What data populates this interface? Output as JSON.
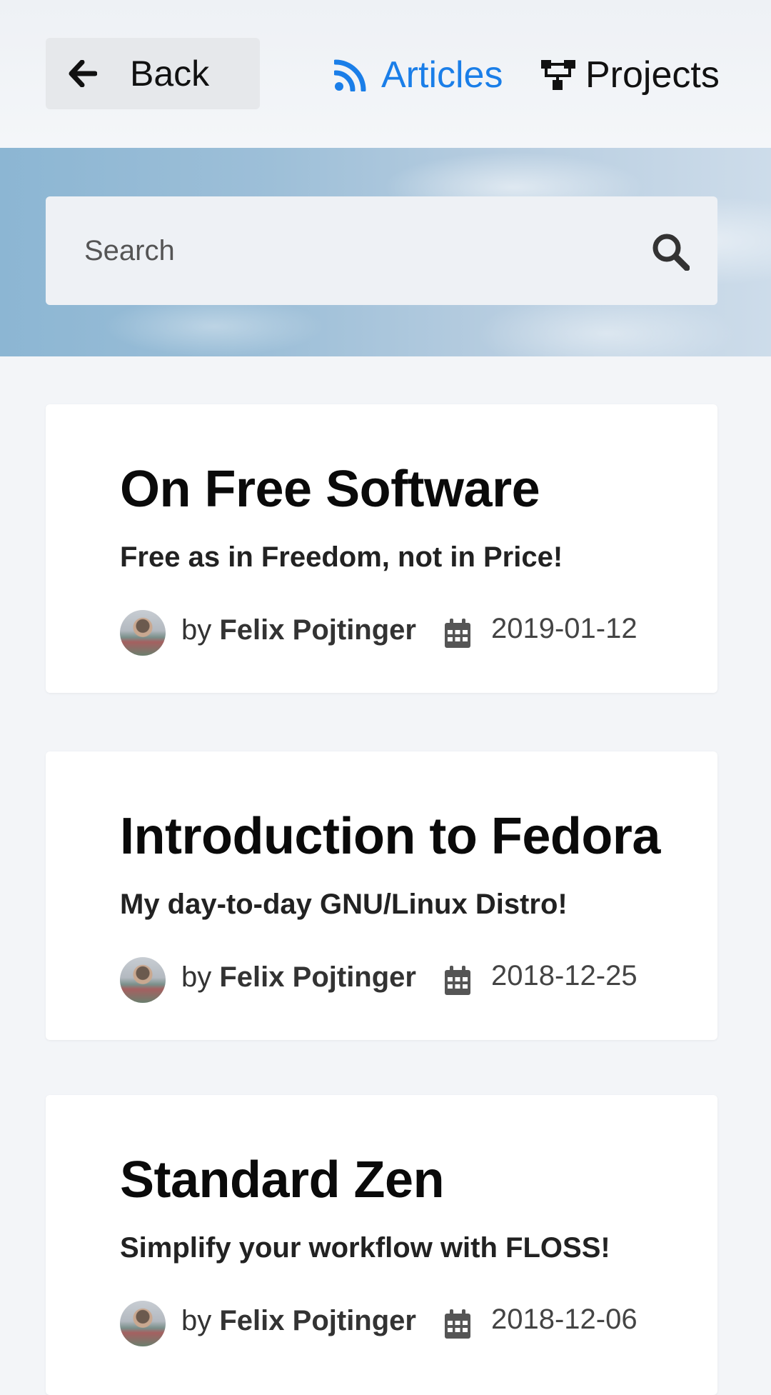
{
  "header": {
    "back_label": "Back",
    "nav": [
      {
        "label": "Articles",
        "icon": "rss-icon",
        "active": true,
        "color": "#1a7ee8"
      },
      {
        "label": "Projects",
        "icon": "sitemap-icon",
        "active": false,
        "color": "#111111"
      }
    ]
  },
  "search": {
    "placeholder": "Search",
    "icon": "search-icon"
  },
  "articles": [
    {
      "title": "On Free Software",
      "subtitle": "Free as in Freedom, not in Price!",
      "by": "by",
      "author": "Felix Pojtinger",
      "date": "2019-01-12"
    },
    {
      "title": "Introduction to Fedora",
      "subtitle": "My day-to-day GNU/Linux Distro!",
      "by": "by",
      "author": "Felix Pojtinger",
      "date": "2018-12-25"
    },
    {
      "title": "Standard Zen",
      "subtitle": "Simplify your workflow with FLOSS!",
      "by": "by",
      "author": "Felix Pojtinger",
      "date": "2018-12-06"
    }
  ]
}
